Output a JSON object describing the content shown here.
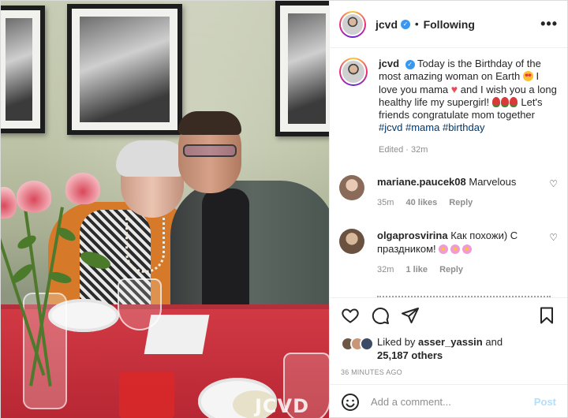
{
  "header": {
    "username": "jcvd",
    "follow_state": "Following",
    "separator": "•"
  },
  "caption": {
    "username": "jcvd",
    "text_part1": "Today is the Birthday of the most amazing woman on Earth",
    "text_part2": "I love you mama",
    "text_part3": "and I wish you a long healthy life my supergirl!",
    "text_part4": "Let's friends congratulate mom together",
    "hashtags": [
      "#jcvd",
      "#mama",
      "#birthday"
    ],
    "meta": "Edited · 32m"
  },
  "comments": [
    {
      "username": "mariane.paucek08",
      "text": "Marvelous",
      "time": "35m",
      "likes": "40 likes",
      "reply": "Reply",
      "avatar_color": "#c89a86"
    },
    {
      "username": "olgaprosvirina",
      "text": "Как похожи) С праздником!",
      "time": "32m",
      "likes": "1 like",
      "reply": "Reply",
      "avatar_color": "#a88a6b"
    }
  ],
  "likes": {
    "prefix": "Liked by",
    "liker": "asser_yassin",
    "conjunction": "and",
    "others": "25,187 others"
  },
  "timestamp": "36 MINUTES AGO",
  "add_comment": {
    "placeholder": "Add a comment...",
    "post_label": "Post"
  },
  "photo": {
    "watermark": "JCVD"
  },
  "icons": {
    "like": "heart-icon",
    "comment": "comment-icon",
    "share": "share-icon",
    "save": "bookmark-icon",
    "emoji": "emoji-icon",
    "more": "more-icon",
    "verified": "verified-badge-icon"
  },
  "colors": {
    "accent": "#0095f6",
    "verified": "#3897f0",
    "post_disabled": "#b2dffc",
    "heart": "#ed4956",
    "hashtag": "#00376b"
  }
}
